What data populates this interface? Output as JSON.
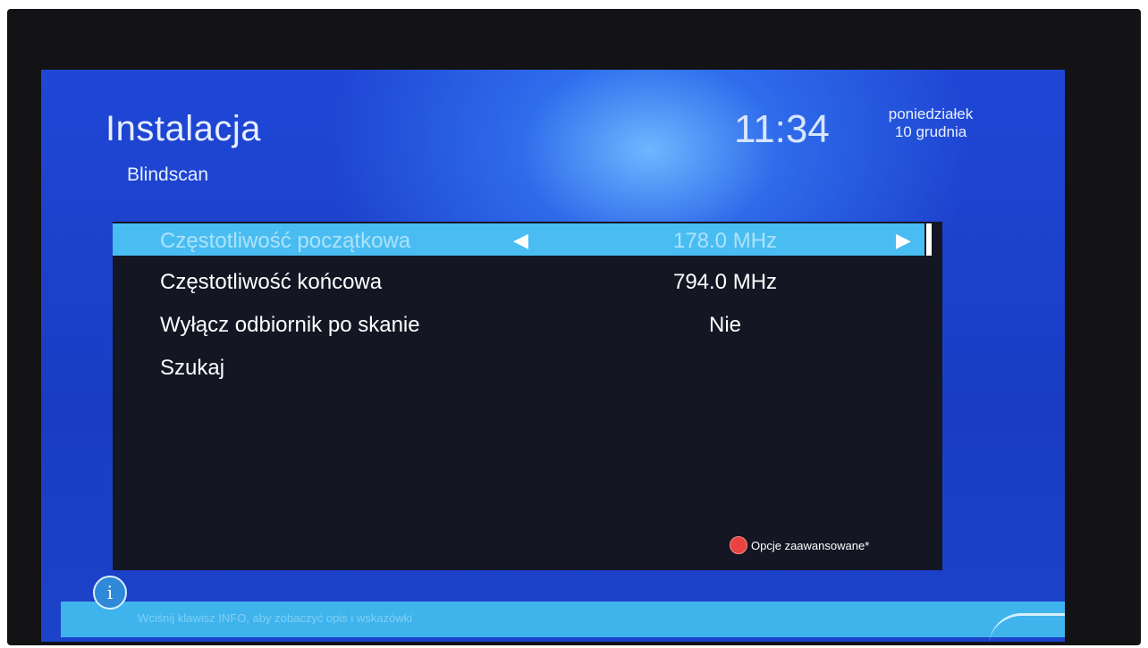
{
  "header": {
    "title": "Instalacja",
    "subtitle": "Blindscan",
    "time": "11:34",
    "day": "poniedziałek",
    "date": "10 grudnia"
  },
  "menu": {
    "items": [
      {
        "label": "Częstotliwość początkowa",
        "value": "178.0 MHz",
        "selected": true
      },
      {
        "label": "Częstotliwość końcowa",
        "value": "794.0 MHz"
      },
      {
        "label": "Wyłącz odbiornik po skanie",
        "value": "Nie"
      },
      {
        "label": "Szukaj",
        "value": ""
      }
    ],
    "arrow_left": "◀",
    "arrow_right": "▶"
  },
  "options": {
    "advanced_label": "Opcje zaawansowane*",
    "color": "#e8433f"
  },
  "footer": {
    "info_icon": "info-icon",
    "info_symbol": "i",
    "info_text": "Wciśnij klawisz INFO, aby zobaczyć opis i wskazówki"
  },
  "colors": {
    "background_blue": "#1f47d6",
    "panel": "#141624",
    "highlight": "#49bdf2",
    "info_bar": "#3fb3ec"
  }
}
